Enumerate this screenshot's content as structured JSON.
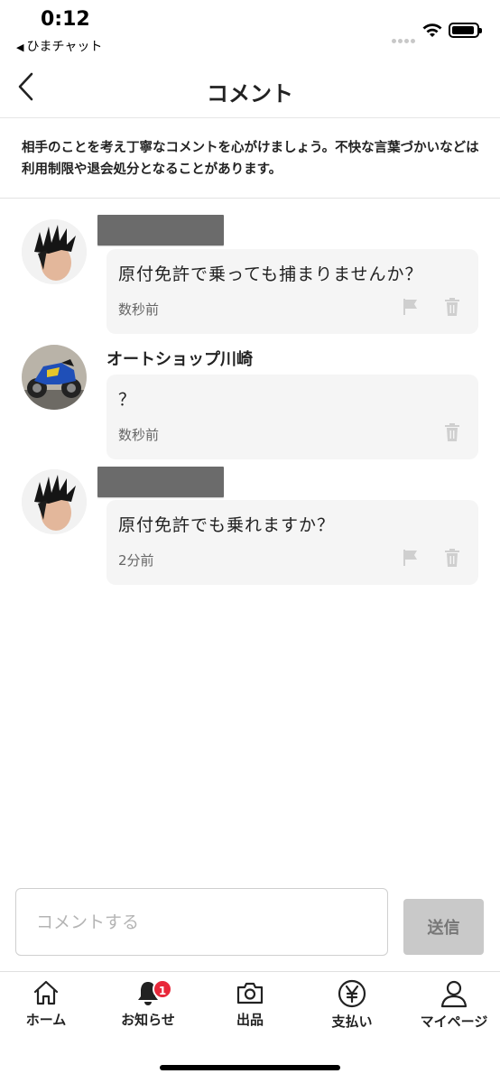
{
  "status_bar": {
    "time": "0:12",
    "back_app": "ひまチャット"
  },
  "header": {
    "title": "コメント"
  },
  "notice": {
    "text": "相手のことを考え丁寧なコメントを心がけましょう。不快な言葉づかいなどは利用制限や退会処分となることがあります。"
  },
  "comments": [
    {
      "author": "",
      "text": "原付免許で乗っても捕まりませんか？",
      "time": "数秒前",
      "show_flag": true
    },
    {
      "author": "オートショップ川崎",
      "text": "？",
      "time": "数秒前",
      "show_flag": false
    },
    {
      "author": "",
      "text": "原付免許でも乗れますか？",
      "time": "2分前",
      "show_flag": true
    }
  ],
  "composer": {
    "placeholder": "コメントする",
    "send_label": "送信"
  },
  "tabs": [
    {
      "label": "ホーム",
      "icon": "home-icon"
    },
    {
      "label": "お知らせ",
      "icon": "bell-icon",
      "badge": "1"
    },
    {
      "label": "出品",
      "icon": "camera-icon"
    },
    {
      "label": "支払い",
      "icon": "yen-icon"
    },
    {
      "label": "マイページ",
      "icon": "person-icon"
    }
  ],
  "colors": {
    "badge": "#e8283a",
    "bubble_bg": "#f5f5f5",
    "send_disabled": "#c9c9c9"
  }
}
